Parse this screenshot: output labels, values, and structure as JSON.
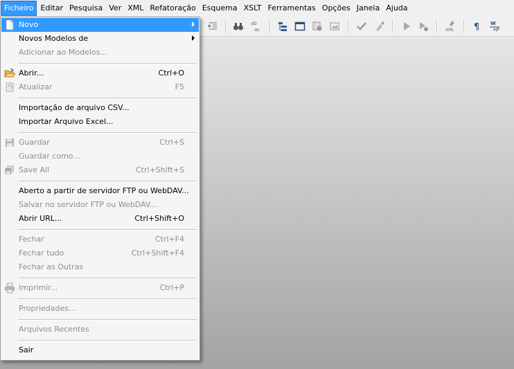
{
  "menubar": {
    "items": [
      "Ficheiro",
      "Editar",
      "Pesquisa",
      "Ver",
      "XML",
      "Refatoração",
      "Esquema",
      "XSLT",
      "Ferramentas",
      "Opções",
      "Janela",
      "Ajuda"
    ]
  },
  "toolbar": {
    "icons": [
      "indent-icon",
      "binoculars-icon",
      "find-replace-icon",
      "tree-view-icon",
      "window-icon",
      "stamp-icon",
      "image-icon",
      "check-icon",
      "validate-icon",
      "run-icon",
      "debug-icon",
      "xml-transform-icon",
      "pilcrow-icon",
      "word-wrap-icon"
    ],
    "replace_text": "ab\nac",
    "xml_text": "XML",
    "wrap_text": "W\nap"
  },
  "file_menu": {
    "novo": "Novo",
    "novos_modelos": "Novos Modelos de",
    "adicionar_modelos": "Adicionar ao Modelos...",
    "abrir": "Abrir...",
    "abrir_sc": "Ctrl+O",
    "atualizar": "Atualizar",
    "atualizar_sc": "F5",
    "importar_csv": "Importação de arquivo CSV...",
    "importar_excel": "Importar Arquivo Excel...",
    "guardar": "Guardar",
    "guardar_sc": "Ctrl+S",
    "guardar_como": "Guardar como...",
    "save_all": "Save All",
    "save_all_sc": "Ctrl+Shift+S",
    "abrir_ftp": "Aberto a partir de servidor FTP ou WebDAV...",
    "salvar_ftp": "Salvar no servidor FTP ou WebDAV...",
    "abrir_url": "Abrir URL...",
    "abrir_url_sc": "Ctrl+Shift+O",
    "fechar": "Fechar",
    "fechar_sc": "Ctrl+F4",
    "fechar_tudo": "Fechar tudo",
    "fechar_tudo_sc": "Ctrl+Shift+F4",
    "fechar_outras": "Fechar as Outras",
    "imprimir": "Imprimir...",
    "imprimir_sc": "Ctrl+P",
    "propriedades": "Propriedades...",
    "arquivos_recentes": "Arquivos Recentes",
    "sair": "Sair"
  },
  "colors": {
    "highlight": "#3399ff",
    "disabled_text": "#8d8d8d"
  }
}
